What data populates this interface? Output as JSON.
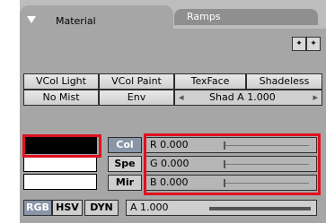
{
  "tabs": {
    "active": "Material",
    "inactive": "Ramps"
  },
  "row1": [
    "VCol Light",
    "VCol Paint",
    "TexFace",
    "Shadeless"
  ],
  "row2": {
    "no_mist": "No Mist",
    "env": "Env",
    "shad_label": "Shad A 1.000",
    "left_arrow": "◂",
    "right_arrow": "▸"
  },
  "color_buttons": [
    "Col",
    "Spe",
    "Mir"
  ],
  "sliders": {
    "r": "R 0.000",
    "g": "G 0.000",
    "b": "B 0.000",
    "a": "A 1.000",
    "r_value": 0,
    "g_value": 0,
    "b_value": 0,
    "a_value": 1
  },
  "modes": [
    "RGB",
    "HSV",
    "DYN"
  ],
  "colors": {
    "col_swatch": "#000000",
    "spe_swatch": "#ffffff",
    "mir_swatch": "#ffffff",
    "highlight": "#e01020"
  },
  "icons": {
    "panel_collapse": "triangle-down-icon",
    "move_panels": "arrows-icon"
  }
}
